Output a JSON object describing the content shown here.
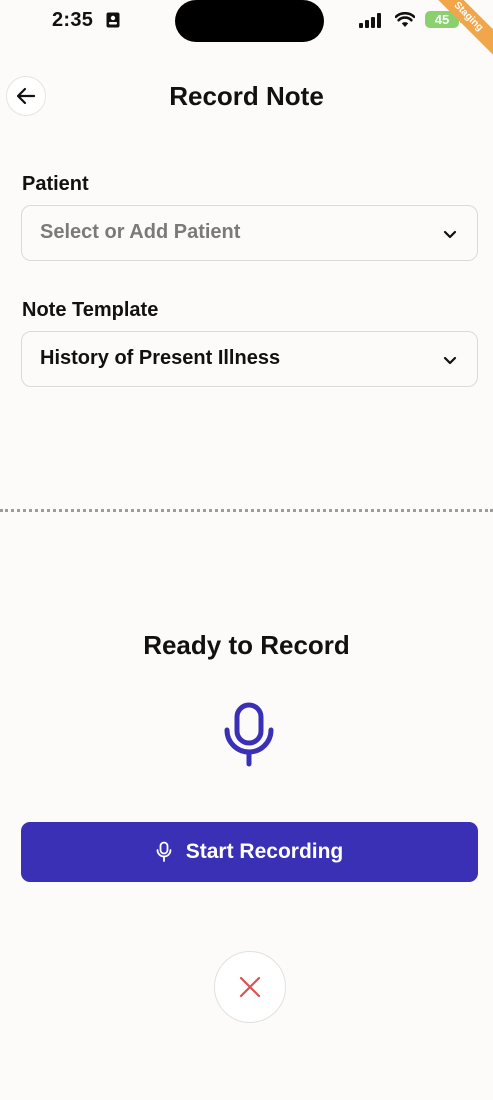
{
  "status_bar": {
    "time": "2:35",
    "battery": "45",
    "ribbon": "Staging"
  },
  "header": {
    "title": "Record Note",
    "back_icon": "arrow-left-icon"
  },
  "form": {
    "patient": {
      "label": "Patient",
      "placeholder": "Select or Add Patient"
    },
    "template": {
      "label": "Note Template",
      "value": "History of Present Illness"
    }
  },
  "recorder": {
    "status": "Ready to Record",
    "start_label": "Start Recording",
    "mic_icon": "microphone-icon",
    "cancel_icon": "close-icon"
  },
  "colors": {
    "accent": "#3a30b5",
    "cancel": "#d9534f",
    "background": "#fcfbfa"
  }
}
